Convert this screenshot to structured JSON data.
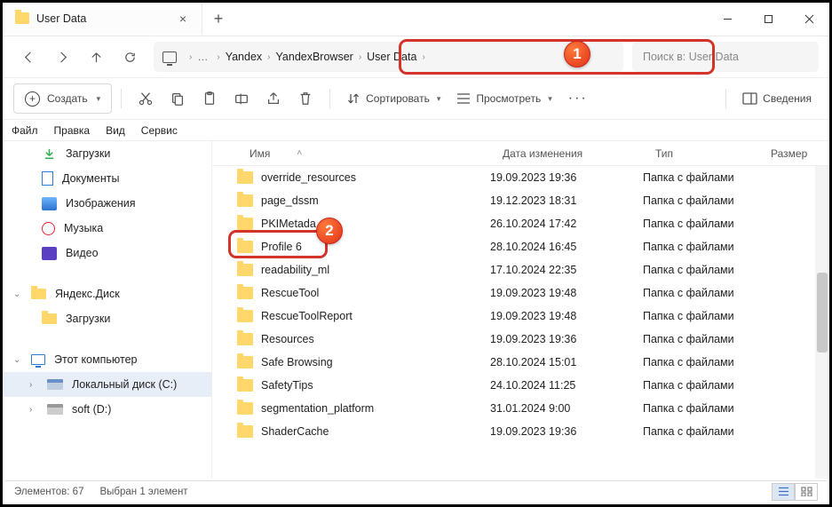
{
  "tab": {
    "title": "User Data"
  },
  "breadcrumbs": [
    "Yandex",
    "YandexBrowser",
    "User Data"
  ],
  "search": {
    "placeholder": "Поиск в: User Data"
  },
  "toolbar": {
    "create": "Создать",
    "sort": "Сортировать",
    "view": "Просмотреть",
    "details": "Сведения"
  },
  "menus": [
    "Файл",
    "Правка",
    "Вид",
    "Сервис"
  ],
  "sidebar": {
    "quick": [
      {
        "label": "Загрузки",
        "icon": "download"
      },
      {
        "label": "Документы",
        "icon": "doc"
      },
      {
        "label": "Изображения",
        "icon": "img"
      },
      {
        "label": "Музыка",
        "icon": "music"
      },
      {
        "label": "Видео",
        "icon": "video"
      }
    ],
    "ydisk": {
      "label": "Яндекс.Диск",
      "child": "Загрузки"
    },
    "pc": {
      "label": "Этот компьютер",
      "drives": [
        "Локальный диск (C:)",
        "soft (D:)"
      ]
    }
  },
  "columns": {
    "name": "Имя",
    "date": "Дата изменения",
    "type": "Тип",
    "size": "Размер"
  },
  "rows": [
    {
      "name": "override_resources",
      "date": "19.09.2023 19:36",
      "type": "Папка с файлами"
    },
    {
      "name": "page_dssm",
      "date": "19.12.2023 18:31",
      "type": "Папка с файлами"
    },
    {
      "name": "PKIMetada",
      "date": "26.10.2024 17:42",
      "type": "Папка с файлами"
    },
    {
      "name": "Profile 6",
      "date": "28.10.2024 16:45",
      "type": "Папка с файлами"
    },
    {
      "name": "readability_ml",
      "date": "17.10.2024 22:35",
      "type": "Папка с файлами"
    },
    {
      "name": "RescueTool",
      "date": "19.09.2023 19:48",
      "type": "Папка с файлами"
    },
    {
      "name": "RescueToolReport",
      "date": "19.09.2023 19:48",
      "type": "Папка с файлами"
    },
    {
      "name": "Resources",
      "date": "19.09.2023 19:36",
      "type": "Папка с файлами"
    },
    {
      "name": "Safe Browsing",
      "date": "28.10.2024 15:01",
      "type": "Папка с файлами"
    },
    {
      "name": "SafetyTips",
      "date": "24.10.2024 11:25",
      "type": "Папка с файлами"
    },
    {
      "name": "segmentation_platform",
      "date": "31.01.2024 9:00",
      "type": "Папка с файлами"
    },
    {
      "name": "ShaderCache",
      "date": "19.09.2023 19:36",
      "type": "Папка с файлами"
    }
  ],
  "status": {
    "count": "Элементов: 67",
    "sel": "Выбран 1 элемент"
  },
  "callouts": {
    "one": "1",
    "two": "2"
  }
}
